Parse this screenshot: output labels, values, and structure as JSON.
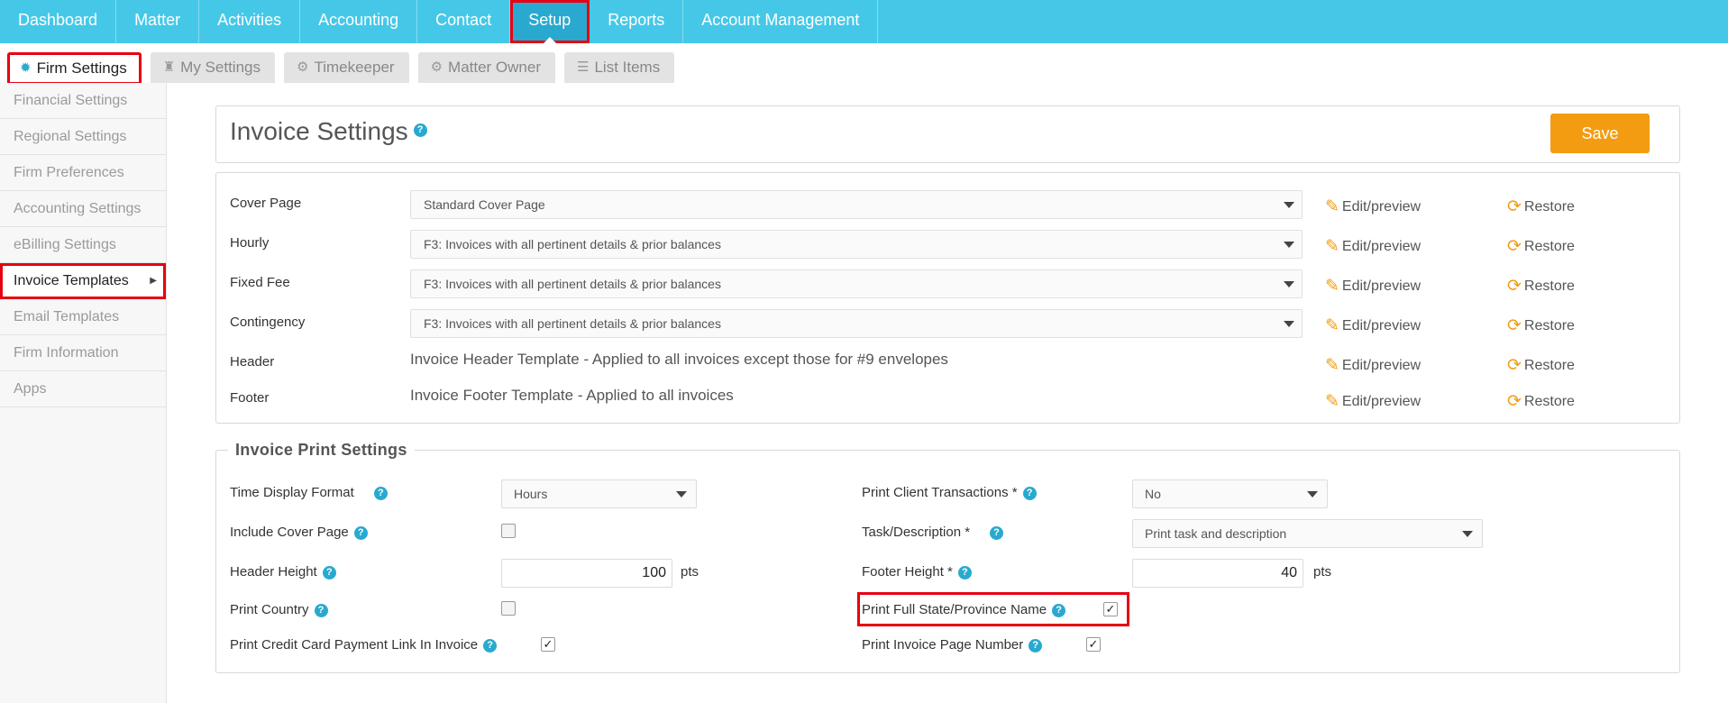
{
  "topnav": {
    "items": [
      {
        "label": "Dashboard"
      },
      {
        "label": "Matter"
      },
      {
        "label": "Activities"
      },
      {
        "label": "Accounting"
      },
      {
        "label": "Contact"
      },
      {
        "label": "Setup"
      },
      {
        "label": "Reports"
      },
      {
        "label": "Account Management"
      }
    ],
    "active": "Setup"
  },
  "subtabs": {
    "items": [
      {
        "label": "Firm Settings",
        "icon": "gear-badge-icon"
      },
      {
        "label": "My Settings",
        "icon": "person-icon"
      },
      {
        "label": "Timekeeper",
        "icon": "gears-icon"
      },
      {
        "label": "Matter Owner",
        "icon": "gear-icon"
      },
      {
        "label": "List Items",
        "icon": "list-icon"
      }
    ],
    "active": "Firm Settings"
  },
  "sidebar": {
    "items": [
      {
        "label": "Financial Settings"
      },
      {
        "label": "Regional Settings"
      },
      {
        "label": "Firm Preferences"
      },
      {
        "label": "Accounting Settings"
      },
      {
        "label": "eBilling Settings"
      },
      {
        "label": "Invoice Templates"
      },
      {
        "label": "Email Templates"
      },
      {
        "label": "Firm Information"
      },
      {
        "label": "Apps"
      }
    ],
    "active": "Invoice Templates"
  },
  "header": {
    "title": "Invoice Settings",
    "save_label": "Save"
  },
  "templates": {
    "edit_label": "Edit/preview",
    "restore_label": "Restore",
    "rows": [
      {
        "label": "Cover Page",
        "value": "Standard Cover Page",
        "type": "select"
      },
      {
        "label": "Hourly",
        "value": "F3: Invoices with all pertinent details & prior balances",
        "type": "select"
      },
      {
        "label": "Fixed Fee",
        "value": "F3: Invoices with all pertinent details & prior balances",
        "type": "select"
      },
      {
        "label": "Contingency",
        "value": "F3: Invoices with all pertinent details & prior balances",
        "type": "select"
      },
      {
        "label": "Header",
        "value": "Invoice Header Template - Applied to all invoices except those for #9 envelopes",
        "type": "text"
      },
      {
        "label": "Footer",
        "value": "Invoice Footer Template - Applied to all invoices",
        "type": "text"
      }
    ]
  },
  "print_settings": {
    "title": "Invoice Print Settings",
    "time_display_format": {
      "label": "Time Display Format",
      "value": "Hours"
    },
    "include_cover_page": {
      "label": "Include Cover Page",
      "checked": false
    },
    "header_height": {
      "label": "Header Height",
      "value": "100",
      "unit": "pts"
    },
    "print_country": {
      "label": "Print Country",
      "checked": false
    },
    "print_credit_card_link": {
      "label": "Print Credit Card Payment Link In Invoice",
      "checked": true
    },
    "print_client_transactions": {
      "label": "Print Client Transactions *",
      "value": "No"
    },
    "task_description": {
      "label": "Task/Description *",
      "value": "Print task and description"
    },
    "footer_height": {
      "label": "Footer Height *",
      "value": "40",
      "unit": "pts"
    },
    "print_full_state": {
      "label": "Print Full State/Province Name",
      "checked": true
    },
    "print_invoice_page_number": {
      "label": "Print Invoice Page Number",
      "checked": true
    }
  },
  "colors": {
    "nav_bg": "#45c8e8",
    "nav_active": "#29a9cf",
    "accent_orange": "#f39c12",
    "highlight_red": "#e60012"
  }
}
